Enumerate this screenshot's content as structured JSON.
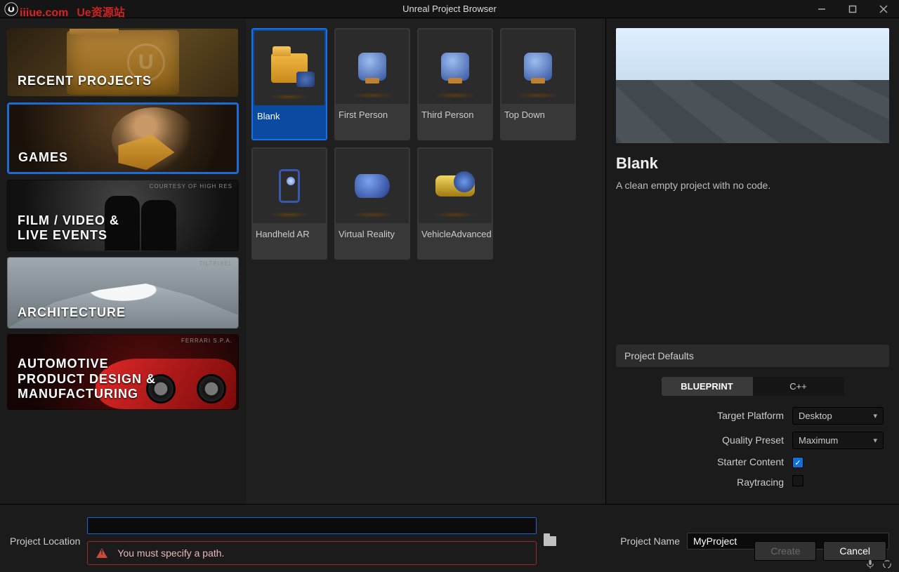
{
  "watermark": {
    "left": "iiiue.com",
    "right": "Ue资源站"
  },
  "window": {
    "title": "Unreal Project Browser"
  },
  "categories": [
    {
      "id": "recent",
      "label": "RECENT PROJECTS",
      "selected": false
    },
    {
      "id": "games",
      "label": "GAMES",
      "selected": true
    },
    {
      "id": "film",
      "label": "FILM / VIDEO &\nLIVE EVENTS",
      "selected": false,
      "credit": "COURTESY OF HIGH RES"
    },
    {
      "id": "arch",
      "label": "ARCHITECTURE",
      "selected": false,
      "credit": "TILTPIXEL"
    },
    {
      "id": "auto",
      "label": "AUTOMOTIVE\nPRODUCT DESIGN &\nMANUFACTURING",
      "selected": false,
      "credit": "FERRARI S.P.A."
    }
  ],
  "templates": [
    {
      "id": "blank",
      "label": "Blank",
      "selected": true
    },
    {
      "id": "first",
      "label": "First Person",
      "selected": false
    },
    {
      "id": "third",
      "label": "Third Person",
      "selected": false
    },
    {
      "id": "topdown",
      "label": "Top Down",
      "selected": false
    },
    {
      "id": "har",
      "label": "Handheld AR",
      "selected": false
    },
    {
      "id": "vr",
      "label": "Virtual Reality",
      "selected": false
    },
    {
      "id": "veh",
      "label": "VehicleAdvanced",
      "selected": false
    }
  ],
  "details": {
    "title": "Blank",
    "description": "A clean empty project with no code.",
    "section_header": "Project Defaults",
    "code_toggle": {
      "options": [
        "BLUEPRINT",
        "C++"
      ],
      "selected": "BLUEPRINT"
    },
    "target_platform": {
      "label": "Target Platform",
      "value": "Desktop"
    },
    "quality_preset": {
      "label": "Quality Preset",
      "value": "Maximum"
    },
    "starter_content": {
      "label": "Starter Content",
      "checked": true
    },
    "raytracing": {
      "label": "Raytracing",
      "checked": false
    }
  },
  "bottom": {
    "location_label": "Project Location",
    "location_value": "",
    "browse_tooltip": "Browse",
    "name_label": "Project Name",
    "name_value": "MyProject",
    "error": "You must specify a path.",
    "create": "Create",
    "cancel": "Cancel"
  }
}
